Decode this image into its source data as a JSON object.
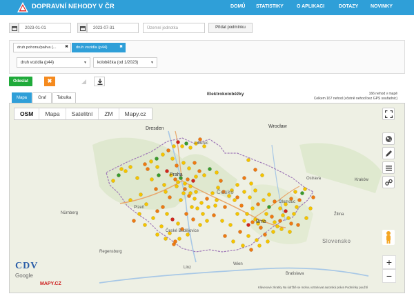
{
  "header": {
    "brand": "DOPRAVNÍ NEHODY V ČR",
    "nav": [
      "DOMŮ",
      "STATISTIKY",
      "O APLIKACI",
      "DOTAZY",
      "NOVINKY"
    ]
  },
  "filters": {
    "date_from": "2023-01-01",
    "date_to": "2023-07-31",
    "region_placeholder": "Územní jednotka",
    "add_condition": "Přidat podmínku"
  },
  "condition_tabs": [
    {
      "label": "druh pohonu/paliva (...",
      "close": "✖"
    },
    {
      "label": "druh vozidla (p44)",
      "close": "✖"
    }
  ],
  "condition_selects": {
    "attribute": "druh vozidla (p44)",
    "value": "koloběžka (od 1/2023)"
  },
  "actions": {
    "send": "Odeslat",
    "clear": "✖"
  },
  "view_tabs": [
    "Mapa",
    "Graf",
    "Tabulka"
  ],
  "map": {
    "title": "Elektrokoloběžky",
    "count_on_map": "166 nehod v mapě",
    "total_note": "Celkem 167 nehod (včetně nehod bez GPS souřadnic)",
    "layers": [
      "OSM",
      "Mapa",
      "Satelitní",
      "ZM",
      "Mapy.cz"
    ],
    "active_layer": "OSM",
    "zoom_in": "+",
    "zoom_out": "−",
    "attribution": "Klávesové zkratky   Na údržbě se mohou vztahovat autorská práva   Podmínky použití",
    "watermark": "CDV",
    "google": "Google",
    "mapy": "MAPY.CZ",
    "cities": [
      {
        "name": "Dresden",
        "big": true
      },
      {
        "name": "Wrocław",
        "big": true
      },
      {
        "name": "Praha",
        "big": true
      },
      {
        "name": "Brno",
        "big": true
      },
      {
        "name": "Nürnberg",
        "big": false
      },
      {
        "name": "Olomouc",
        "big": false
      },
      {
        "name": "Ostrava",
        "big": false
      },
      {
        "name": "Kraków",
        "big": false
      },
      {
        "name": "Bratislava",
        "big": false
      },
      {
        "name": "Wien",
        "big": false
      },
      {
        "name": "Liberec",
        "big": false
      },
      {
        "name": "Plzeň",
        "big": false
      },
      {
        "name": "České Budějovice",
        "big": false
      },
      {
        "name": "Linz",
        "big": false
      },
      {
        "name": "Žilina",
        "big": false
      },
      {
        "name": "Regensburg",
        "big": false
      }
    ],
    "states": [
      "Česko",
      "Slovensko"
    ],
    "colors": {
      "yellow": "#f5c400",
      "orange": "#ee7a12",
      "red": "#d2261c",
      "green": "#3a9a2b"
    }
  }
}
